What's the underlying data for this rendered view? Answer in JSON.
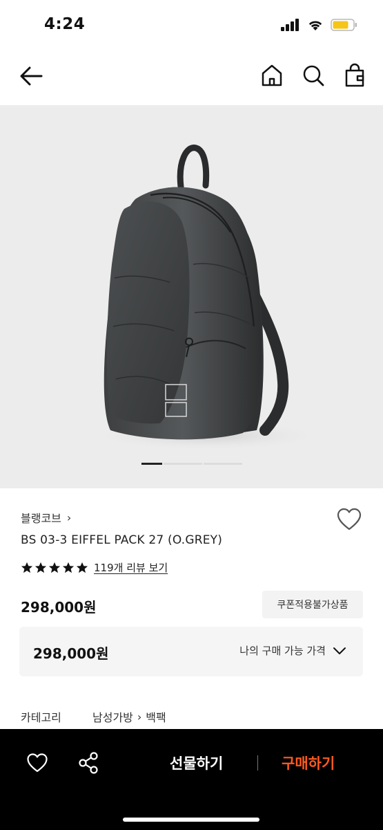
{
  "status_bar": {
    "time": "4:24",
    "icons": [
      "signal-icon",
      "wifi-icon",
      "battery-icon"
    ],
    "battery_color": "#f5c518"
  },
  "nav": {
    "icons": [
      "back-arrow-icon",
      "home-icon",
      "search-icon",
      "shopping-bag-icon"
    ]
  },
  "gallery": {
    "image": "backpack-photo",
    "total_slides": 3,
    "active_slide": 1
  },
  "product": {
    "brand": "블랭코브",
    "brand_chevron": "›",
    "title": "BS 03-3 EIFFEL PACK 27 (O.GREY)",
    "rating_stars": 5,
    "review_link": "119개 리뷰 보기",
    "price": "298,000원",
    "coupon_badge": "쿠폰적용불가상품"
  },
  "my_price": {
    "value": "298,000원",
    "label": "나의 구매 가능 가격"
  },
  "category": {
    "key": "카테고리",
    "path": [
      "남성가방",
      "백팩"
    ],
    "separator": "›"
  },
  "bottom_bar": {
    "gift_label": "선물하기",
    "buy_label": "구매하기",
    "buy_color": "#ff5a1f"
  }
}
